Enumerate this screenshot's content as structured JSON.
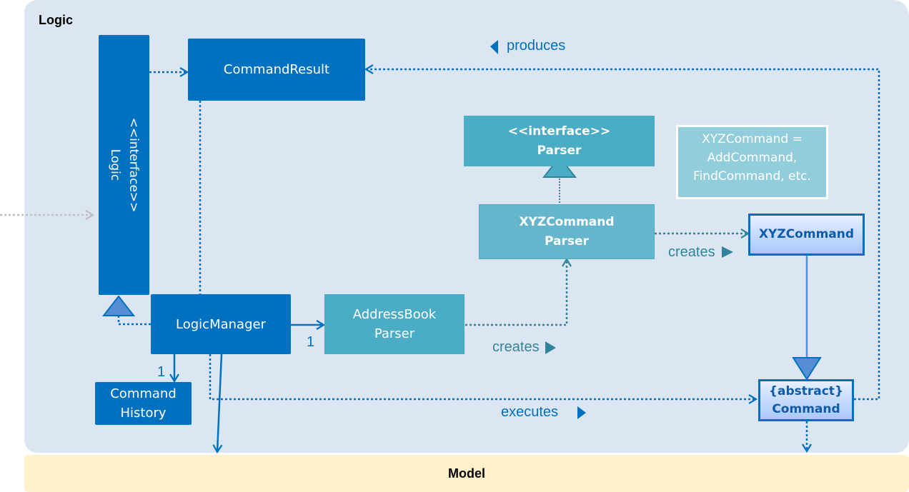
{
  "packages": {
    "logic": {
      "title": "Logic"
    },
    "model": {
      "title": "Model"
    }
  },
  "classes": {
    "logic_interface": {
      "stereotype": "<<interface>>",
      "name": "Logic"
    },
    "command_result": {
      "name": "CommandResult"
    },
    "parser_interface": {
      "stereotype": "<<interface>>",
      "name": "Parser"
    },
    "xyz_command_parser": {
      "line1": "XYZCommand",
      "line2": "Parser"
    },
    "xyz_command": {
      "name": "XYZCommand"
    },
    "logic_manager": {
      "name": "LogicManager"
    },
    "address_book_parser": {
      "line1": "AddressBook",
      "line2": "Parser"
    },
    "command_history": {
      "line1": "Command",
      "line2": "History"
    },
    "command": {
      "stereotype": "{abstract}",
      "name": "Command"
    }
  },
  "note": {
    "line1": "XYZCommand =",
    "line2": "AddCommand,",
    "line3": "FindCommand, etc."
  },
  "labels": {
    "produces": "produces",
    "creates_top": "creates",
    "creates_bottom": "creates",
    "executes": "executes",
    "mult_parser": "1",
    "mult_history": "1"
  },
  "colors": {
    "dark_blue": "#0070c0",
    "teal": "#4bacc6",
    "teal_text": "#31849b",
    "logic_bg": "#dce6f2",
    "model_bg": "#fff1cc",
    "note_bg": "#92cddc"
  }
}
